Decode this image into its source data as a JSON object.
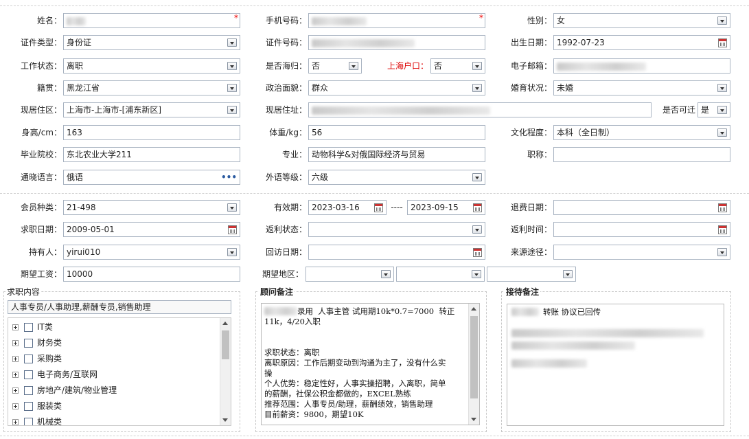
{
  "row1": {
    "name_label": "姓名：",
    "name_required": "*",
    "phone_label": "手机号码：",
    "phone_required": "*",
    "gender_label": "性别：",
    "gender_value": "女"
  },
  "row2": {
    "idtype_label": "证件类型：",
    "idtype_value": "身份证",
    "idnum_label": "证件号码：",
    "dob_label": "出生日期：",
    "dob_value": "1992-07-23"
  },
  "row3": {
    "work_label": "工作状态：",
    "work_value": "离职",
    "returnee_label": "是否海归：",
    "returnee_value": "否",
    "hukou_label": "上海户口：",
    "hukou_value": "否",
    "email_label": "电子邮箱："
  },
  "row4": {
    "native_label": "籍贯：",
    "native_value": "黑龙江省",
    "political_label": "政治面貌：",
    "political_value": "群众",
    "marital_label": "婚育状况：",
    "marital_value": "未婚"
  },
  "row5": {
    "residence_label": "现居住区：",
    "residence_value": "上海市-上海市-[浦东新区]",
    "address_label": "现居住址：",
    "relocate_label": "是否可迁",
    "relocate_value": "是"
  },
  "row6": {
    "height_label": "身高/cm：",
    "height_value": "163",
    "weight_label": "体重/kg：",
    "weight_value": "56",
    "edu_label": "文化程度：",
    "edu_value": "本科（全日制）"
  },
  "row7": {
    "school_label": "毕业院校：",
    "school_value": "东北农业大学211",
    "major_label": "专业：",
    "major_value": "动物科学&对俄国际经济与贸易",
    "title_label": "职称："
  },
  "row8": {
    "lang_label": "通晓语言：",
    "lang_value": "俄语",
    "lang_more": "•••",
    "foreign_label": "外语等级：",
    "foreign_value": "六级"
  },
  "row9": {
    "member_label": "会员种类：",
    "member_value": "21-498",
    "valid_label": "有效期：",
    "valid_from": "2023-03-16",
    "valid_sep": "----",
    "valid_to": "2023-09-15",
    "refund_label": "退费日期："
  },
  "row10": {
    "jobdate_label": "求职日期：",
    "jobdate_value": "2009-05-01",
    "rebate_label": "返利状态：",
    "rebatetime_label": "返利时间："
  },
  "row11": {
    "holder_label": "持有人：",
    "holder_value": "yirui010",
    "visit_label": "回访日期：",
    "source_label": "来源途径："
  },
  "row12": {
    "salary_label": "期望工资：",
    "salary_value": "10000",
    "region_label": "期望地区："
  },
  "job_content": {
    "title": "求职内容",
    "summary": "人事专员/人事助理,薪酬专员,销售助理",
    "tree": [
      "IT类",
      "财务类",
      "采购类",
      "电子商务/互联网",
      "房地产/建筑/物业管理",
      "服装类",
      "机械类"
    ]
  },
  "advisor_note": {
    "title": "顾问备注",
    "text": "录用  人事主管 试用期10k*0.7=7000  转正\n11k，4/20入职\n\n\n求职状态：离职\n离职原因：工作后期变动到沟通为主了，没有什么实\n操\n个人优势：稳定性好，人事实操招聘，入离职，简单\n的薪酬，社保公积金都做的，EXCEL熟练\n推荐范围：人事专员/助理，薪酬绩效，销售助理\n目前薪资：9800，期望10K"
  },
  "reception_note": {
    "title": "接待备注",
    "text": "转账 协议已回传"
  },
  "colors": {
    "border": "#a8b3c1",
    "accent_red": "#dd0000"
  }
}
